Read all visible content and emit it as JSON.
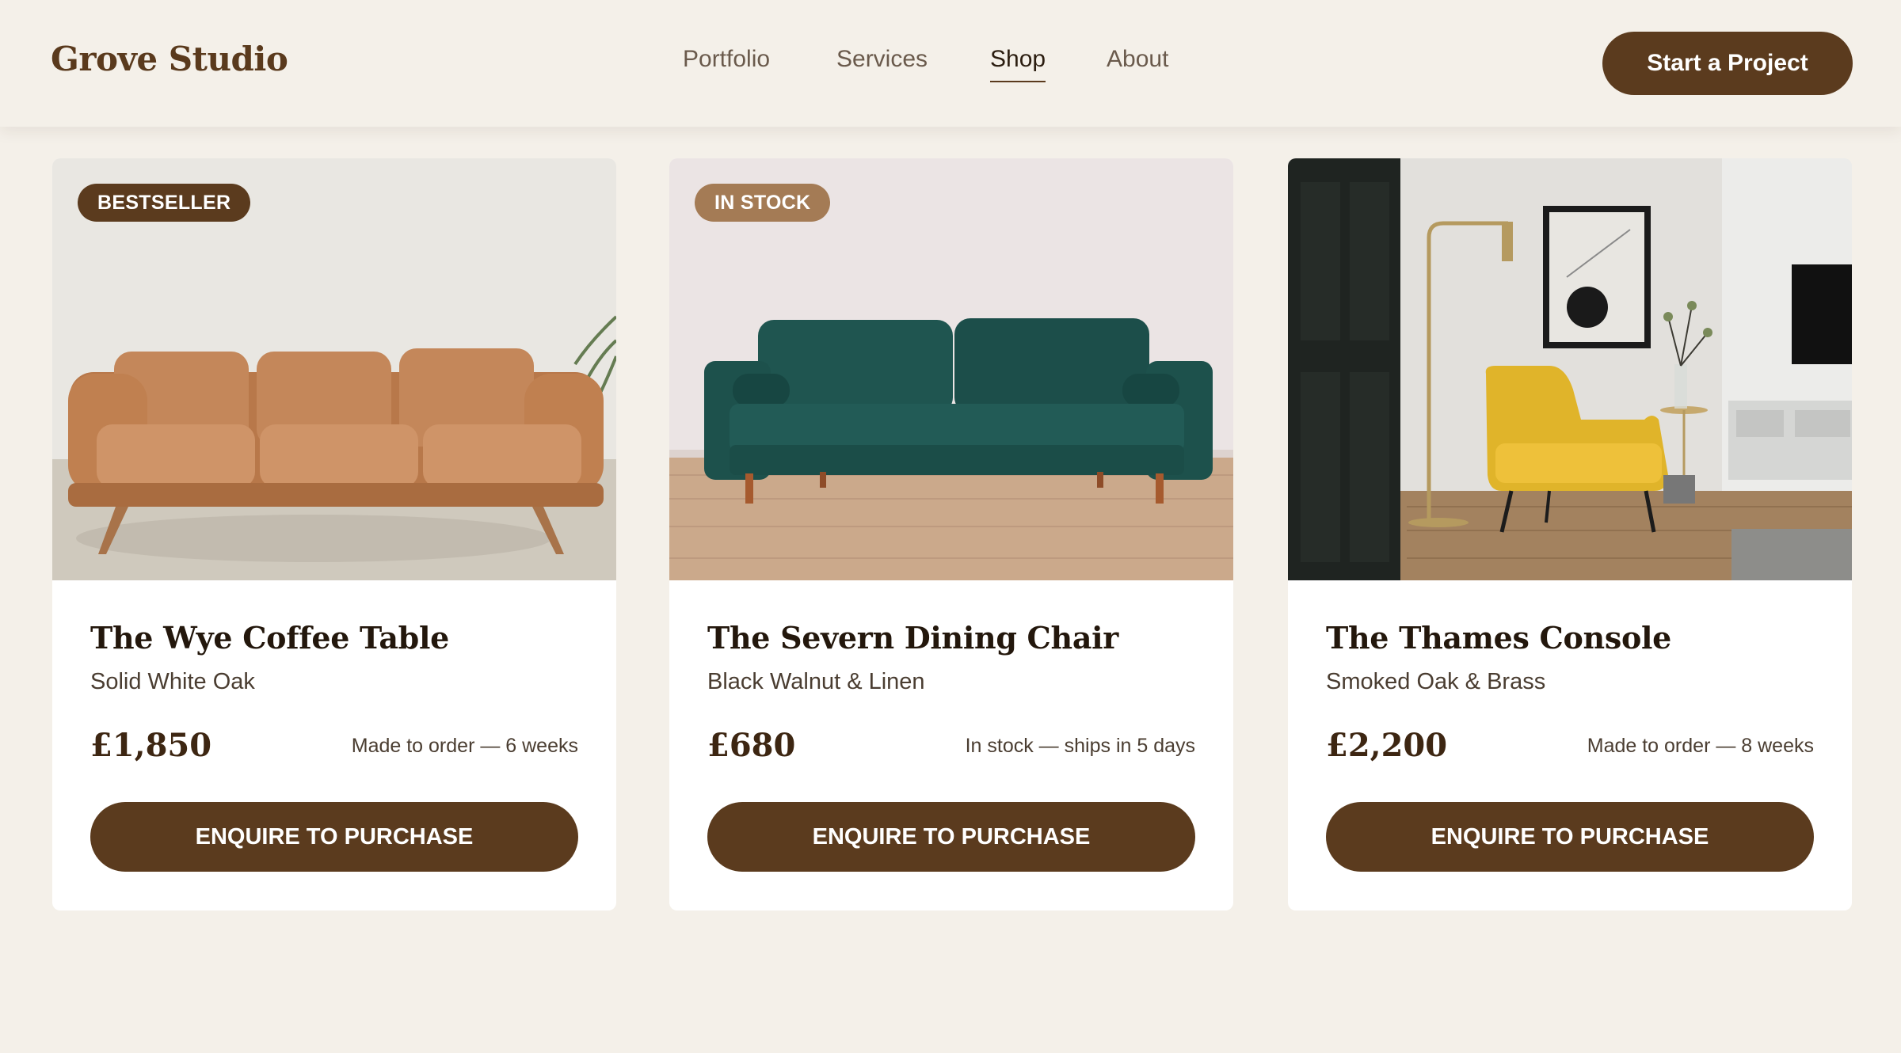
{
  "header": {
    "brand": "Grove Studio",
    "nav": [
      {
        "label": "Portfolio",
        "active": false
      },
      {
        "label": "Services",
        "active": false
      },
      {
        "label": "Shop",
        "active": true
      },
      {
        "label": "About",
        "active": false
      }
    ],
    "cta_label": "Start a Project"
  },
  "products": [
    {
      "badge": "BESTSELLER",
      "title": "The Wye Coffee Table",
      "material": "Solid White Oak",
      "price": "£1,850",
      "lead_time": "Made to order — 6 weeks",
      "button": "ENQUIRE TO PURCHASE",
      "image": "tan-leather-sofa"
    },
    {
      "badge": "IN STOCK",
      "title": "The Severn Dining Chair",
      "material": "Black Walnut & Linen",
      "price": "£680",
      "lead_time": "In stock — ships in 5 days",
      "button": "ENQUIRE TO PURCHASE",
      "image": "green-velvet-sofa"
    },
    {
      "badge": "",
      "title": "The Thames Console",
      "material": "Smoked Oak & Brass",
      "price": "£2,200",
      "lead_time": "Made to order — 8 weeks",
      "button": "ENQUIRE TO PURCHASE",
      "image": "yellow-armchair-living-room"
    }
  ],
  "colors": {
    "background": "#f4f0e9",
    "brand_brown": "#5b3b1e",
    "badge_light": "#a47b55",
    "card": "#ffffff"
  }
}
